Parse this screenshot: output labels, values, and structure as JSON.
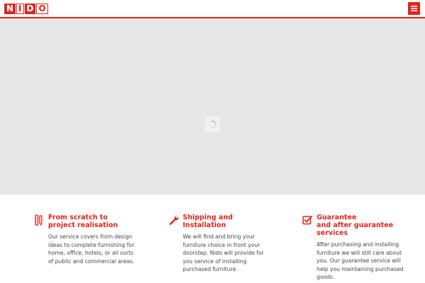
{
  "header": {
    "logo": {
      "letters": [
        "N",
        "I",
        "D",
        "O"
      ],
      "text": "NIDO"
    },
    "menu_icon": "hamburger-menu-icon"
  },
  "hero": {
    "loader_icon": "loading-spinner-icon"
  },
  "features": [
    {
      "icon": "pencil-ruler-icon",
      "title": "From scratch to\nproject realisation",
      "text": "Our service covers from design ideas to complete furnishing for home, office, hotels, or all sorts of public and commercial areas."
    },
    {
      "icon": "wrench-icon",
      "title": "Shipping and\nInstallation",
      "text": "We will find and bring your furniture choice in front your doorstep. Nido will provide for you service of installing purchased furniture."
    },
    {
      "icon": "checkbox-icon",
      "title": "Guarantee\nand after guarantee\nservices",
      "text": "After purchasing and installing furniture we will still care about you. Our guarantee service will help you maintaining purchased goods."
    }
  ],
  "colors": {
    "accent": "#e2231a",
    "hero_bg": "#e7e7e7"
  }
}
